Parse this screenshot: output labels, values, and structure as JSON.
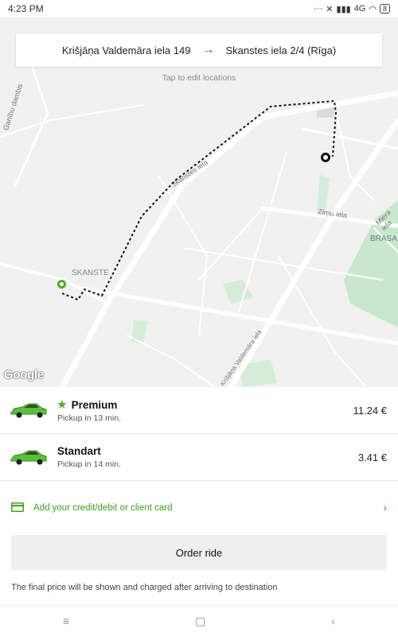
{
  "status": {
    "time": "4:23 PM",
    "network": "4G",
    "battery": "8"
  },
  "route": {
    "from": "Krišjāņa Valdemāra iela 149",
    "to": "Skanstes iela 2/4 (Rīga)",
    "edit_hint": "Tap to edit locations"
  },
  "map": {
    "labels": {
      "ganibu": "Ganību dambis",
      "skanstes_street": "Skanstes iela",
      "skanste": "SKANSTE",
      "zirnu": "Zirņu iela",
      "miera": "Miera iela",
      "brasa": "BRASA",
      "valdemara": "Krišjāņa Valdemāra iela"
    },
    "google": "Google"
  },
  "rides": [
    {
      "name": "Premium",
      "pickup": "Pickup in 13 min.",
      "price": "11.24 €",
      "starred": true
    },
    {
      "name": "Standart",
      "pickup": "Pickup in 14 min.",
      "price": "3.41 €",
      "starred": false
    }
  ],
  "payment": {
    "add_card_label": "Add your credit/debit or client card"
  },
  "order": {
    "button_label": "Order ride",
    "note": "The final price will be shown and charged after arriving to destination"
  },
  "colors": {
    "accent": "#3ea21a",
    "car": "#5cbf3a"
  }
}
